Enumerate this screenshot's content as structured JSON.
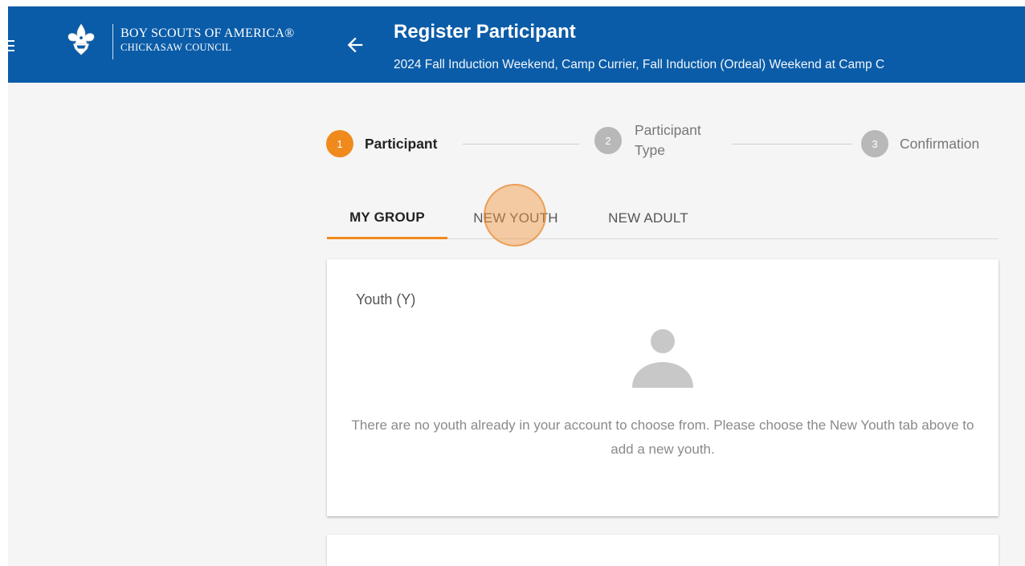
{
  "header": {
    "org_line1": "BOY SCOUTS OF AMERICA®",
    "org_line2": "CHICKASAW COUNCIL",
    "title": "Register Participant",
    "subtitle": "2024 Fall Induction Weekend, Camp Currier, Fall Induction (Ordeal) Weekend at Camp C",
    "background_color": "#0a5ca8"
  },
  "stepper": {
    "steps": [
      {
        "number": "1",
        "label": "Participant",
        "state": "active"
      },
      {
        "number": "2",
        "label_line1": "Participant",
        "label_line2": "Type",
        "state": "inactive"
      },
      {
        "number": "3",
        "label": "Confirmation",
        "state": "inactive"
      }
    ],
    "active_color": "#f08a1c",
    "inactive_color": "#b8b8b8"
  },
  "tabs": [
    {
      "label": "MY GROUP",
      "active": true
    },
    {
      "label": "NEW YOUTH",
      "active": false
    },
    {
      "label": "NEW ADULT",
      "active": false
    }
  ],
  "youth_card": {
    "title": "Youth (Y)",
    "icon": "person-icon",
    "empty_message": "There are no youth already in your account to choose from. Please choose the New Youth tab above to add a new youth."
  },
  "accent_color": "#f08a1c"
}
